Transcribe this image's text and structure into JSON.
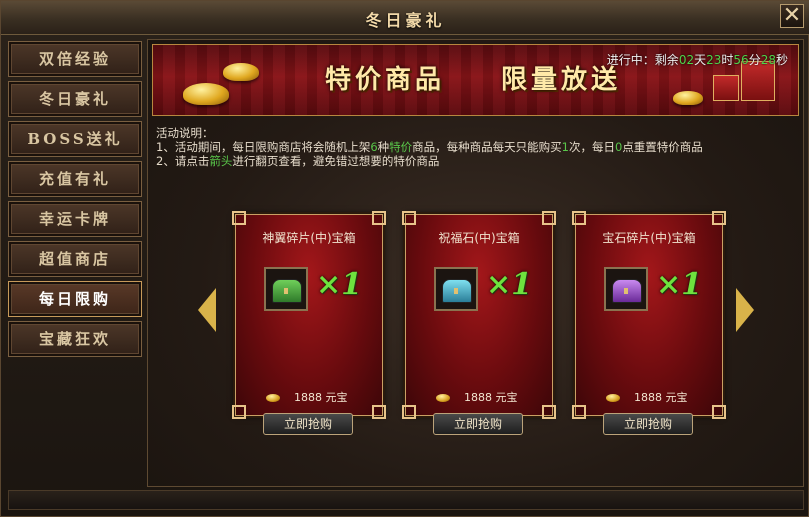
{
  "window": {
    "title": "冬日豪礼",
    "close_label": "✕"
  },
  "sidebar": {
    "items": [
      {
        "label": "双倍经验"
      },
      {
        "label": "冬日豪礼"
      },
      {
        "label": "BOSS送礼"
      },
      {
        "label": "充值有礼"
      },
      {
        "label": "幸运卡牌"
      },
      {
        "label": "超值商店"
      },
      {
        "label": "每日限购"
      },
      {
        "label": "宝藏狂欢"
      }
    ]
  },
  "banner": {
    "title": "特价商品",
    "subtitle": "限量放送"
  },
  "countdown": {
    "prefix": "进行中：剩余",
    "days": "02",
    "days_unit": "天",
    "hours": "23",
    "hours_unit": "时",
    "minutes": "56",
    "minutes_unit": "分",
    "seconds": "28",
    "seconds_unit": "秒"
  },
  "description": {
    "heading": "活动说明：",
    "line1_a": "1、活动期间，每日限购商店将会随机上架",
    "line1_count": "6",
    "line1_b": "种",
    "line1_hl": "特价",
    "line1_c": "商品，每种商品每天只能购买",
    "line1_times": "1",
    "line1_d": "次，每日",
    "line1_zero": "0",
    "line1_e": "点重置特价商品",
    "line2_a": "2、请点击",
    "line2_hl": "箭头",
    "line2_b": "进行翻页查看，避免错过想要的特价商品"
  },
  "cards": [
    {
      "name": "神翼碎片(中)宝箱",
      "qty": "×1",
      "price": "1888",
      "currency": "元宝",
      "buy_label": "立即抢购",
      "chest_color": "#3f9a3a"
    },
    {
      "name": "祝福石(中)宝箱",
      "qty": "×1",
      "price": "1888",
      "currency": "元宝",
      "buy_label": "立即抢购",
      "chest_color": "#3aa0b8"
    },
    {
      "name": "宝石碎片(中)宝箱",
      "qty": "×1",
      "price": "1888",
      "currency": "元宝",
      "buy_label": "立即抢购",
      "chest_color": "#9a4ac0"
    }
  ],
  "icons": {
    "prev": "arrow-left-icon",
    "next": "arrow-right-icon",
    "close": "close-icon",
    "currency": "gold-ingot-icon",
    "chest": "treasure-chest-icon"
  }
}
